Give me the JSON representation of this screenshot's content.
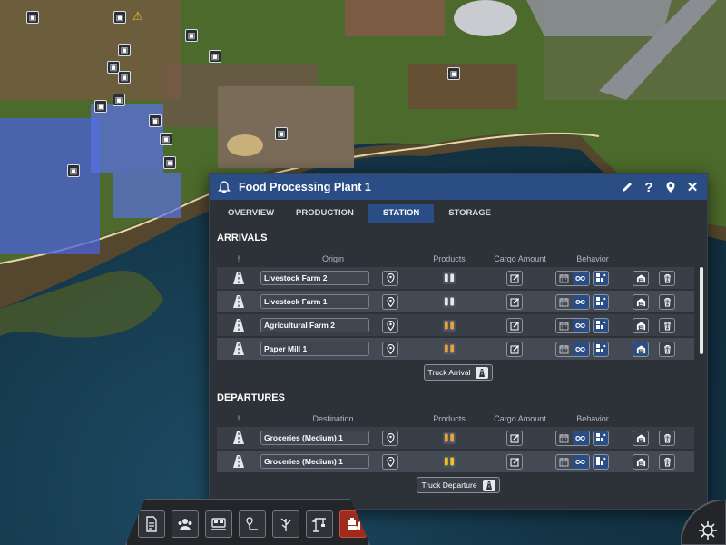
{
  "window": {
    "title": "Food Processing Plant 1",
    "icons": [
      "bell-icon",
      "pencil-icon",
      "help-icon",
      "locate-icon",
      "close-icon"
    ],
    "help_glyph": "?",
    "close_glyph": "✕"
  },
  "tabs": [
    {
      "label": "OVERVIEW",
      "active": false
    },
    {
      "label": "PRODUCTION",
      "active": false
    },
    {
      "label": "STATION",
      "active": true
    },
    {
      "label": "STORAGE",
      "active": false
    }
  ],
  "arrivals": {
    "title": "ARRIVALS",
    "columns": {
      "flag": "!",
      "origin": "Origin",
      "products": "Products",
      "cargo": "Cargo Amount",
      "behavior": "Behavior"
    },
    "rows": [
      {
        "name": "Livestock Farm 2",
        "product_icon": "livestock-icon",
        "product_color": "#e6e9ec",
        "load_active": false
      },
      {
        "name": "Livestock Farm 1",
        "product_icon": "livestock-icon",
        "product_color": "#e6e9ec",
        "load_active": false
      },
      {
        "name": "Agricultural Farm 2",
        "product_icon": "grain-icon",
        "product_color": "#e8a23a",
        "load_active": false
      },
      {
        "name": "Paper Mill 1",
        "product_icon": "paper-icon",
        "product_color": "#e8a23a",
        "load_active": true
      }
    ],
    "add_button": "Truck Arrival"
  },
  "departures": {
    "title": "DEPARTURES",
    "columns": {
      "flag": "!",
      "destination": "Destination",
      "products": "Products",
      "cargo": "Cargo Amount",
      "behavior": "Behavior"
    },
    "rows": [
      {
        "name": "Groceries (Medium) 1",
        "product_icon": "food-icon",
        "product_color": "#e8a23a"
      },
      {
        "name": "Groceries (Medium) 1",
        "product_icon": "food-icon",
        "product_color": "#f2c12e"
      }
    ],
    "add_button": "Truck Departure"
  },
  "toolbar": {
    "tools": [
      "document-icon",
      "people-icon",
      "train-icon",
      "route-icon",
      "tree-icon",
      "crane-icon",
      "bulldozer-icon"
    ],
    "active": "bulldozer-icon"
  },
  "colors": {
    "accent": "#2a4d86",
    "panel": "#2d3138",
    "bulldozer": "#a02a1c"
  }
}
